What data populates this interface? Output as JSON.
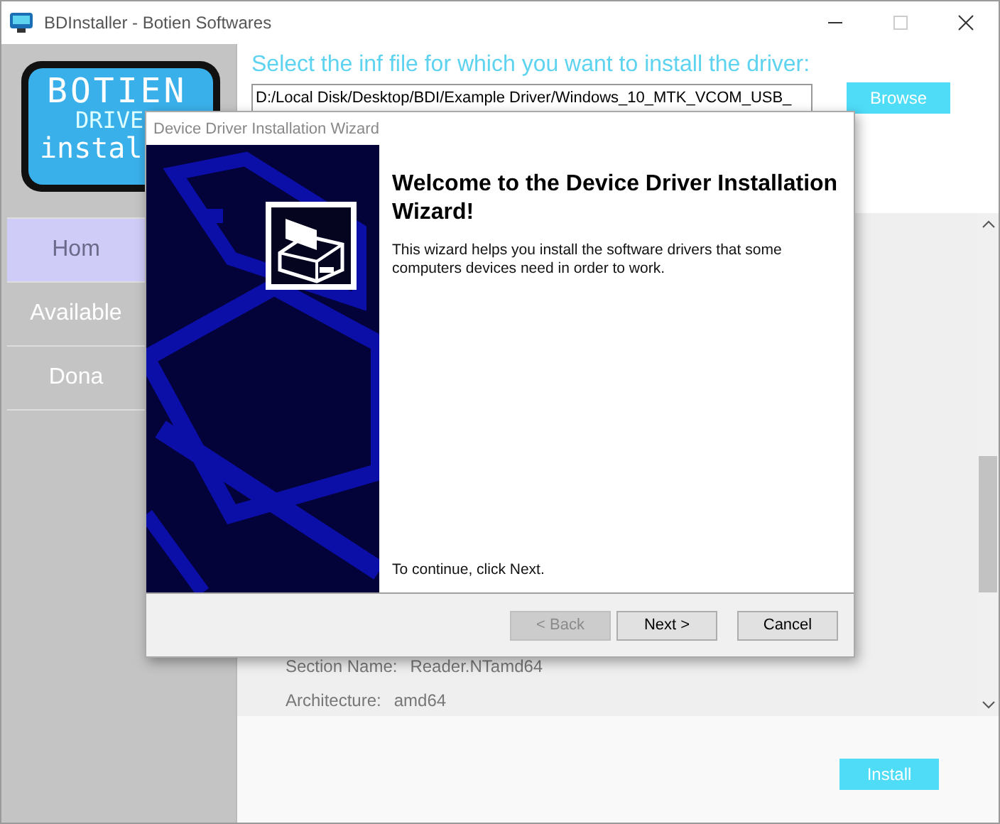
{
  "window": {
    "title": "BDInstaller - Botien Softwares",
    "controls": [
      {
        "kind": "minimize",
        "disabled": false
      },
      {
        "kind": "maximize",
        "disabled": true
      },
      {
        "kind": "close",
        "disabled": false
      }
    ]
  },
  "logo": {
    "lines": [
      "BOTIEN",
      "DRIVE",
      "instal"
    ]
  },
  "sidebar": {
    "items": [
      {
        "label": "Hom",
        "selected": true
      },
      {
        "label": "Available",
        "selected": false
      },
      {
        "label": "Dona",
        "selected": false
      }
    ]
  },
  "main": {
    "heading": "Select the inf file for which you want to install the driver:",
    "path_field": {
      "value": "D:/Local Disk/Desktop/BDI/Example Driver/Windows_10_MTK_VCOM_USB_"
    },
    "browse_button": "Browse",
    "details": [
      {
        "label": "Section Name:",
        "value": "Reader.NTamd64"
      },
      {
        "label": "Architecture:",
        "value": "amd64"
      }
    ],
    "install_button": "Install"
  },
  "dialog": {
    "title": "Device Driver Installation Wizard",
    "heading": "Welcome to the Device Driver Installation Wizard!",
    "body": "This wizard helps you install the software drivers that some computers devices need in order to work.",
    "footer_text": "To continue, click Next.",
    "buttons": [
      {
        "label": "< Back",
        "disabled": true
      },
      {
        "label": "Next >",
        "disabled": false
      },
      {
        "label": "Cancel",
        "disabled": false
      }
    ]
  }
}
